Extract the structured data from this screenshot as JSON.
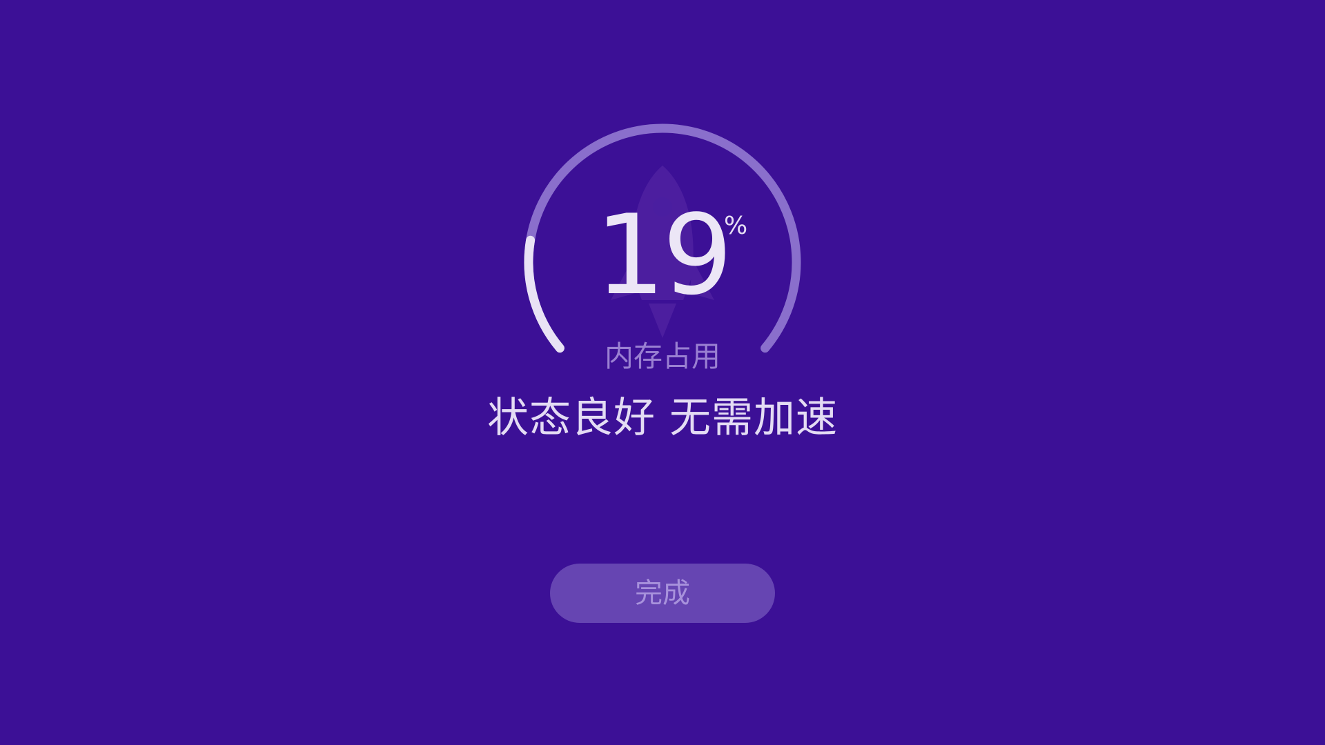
{
  "memory": {
    "usage_percent": 19,
    "value_text": "19",
    "unit": "%",
    "caption": "内存占用"
  },
  "status": {
    "message": "状态良好 无需加速"
  },
  "actions": {
    "done_label": "完成"
  },
  "colors": {
    "background": "#3c1096",
    "arc_active": "#e9e2f5",
    "arc_track": "#8a6fcc",
    "button_bg": "#6645b2",
    "button_text": "#a892dc"
  },
  "icons": {
    "center_graphic": "rocket-icon"
  }
}
